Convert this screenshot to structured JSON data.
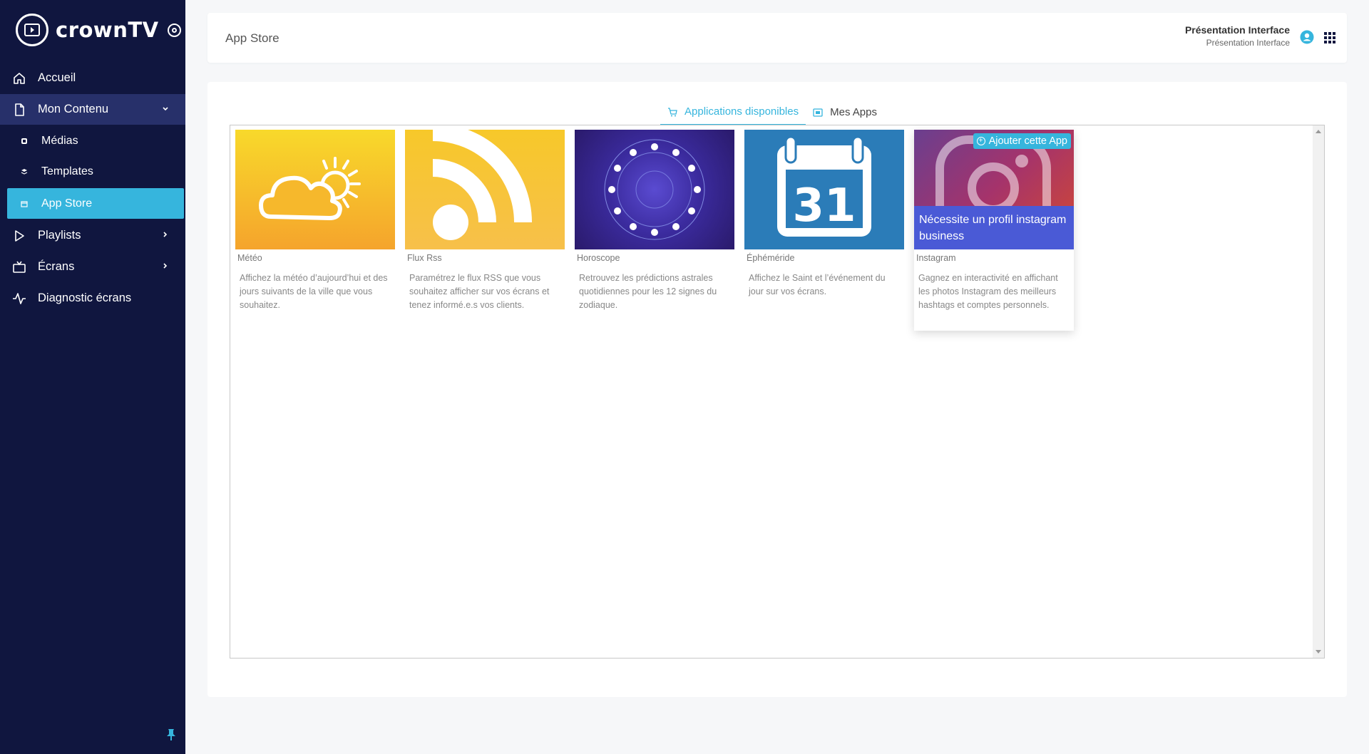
{
  "brand": {
    "name": "crownTV"
  },
  "sidebar": {
    "items": [
      {
        "label": "Accueil",
        "icon": "home-icon"
      },
      {
        "label": "Mon Contenu",
        "icon": "file-icon",
        "expanded": true
      },
      {
        "label": "Playlists",
        "icon": "play-icon"
      },
      {
        "label": "Écrans",
        "icon": "tv-icon"
      },
      {
        "label": "Diagnostic écrans",
        "icon": "activity-icon"
      }
    ],
    "subitems": [
      {
        "label": "Médias",
        "icon": "media-icon"
      },
      {
        "label": "Templates",
        "icon": "template-icon"
      },
      {
        "label": "App Store",
        "icon": "store-icon",
        "active": true
      }
    ],
    "pin_icon": "pin-icon"
  },
  "header": {
    "title": "App Store",
    "user_name": "Présentation Interface",
    "user_sub": "Présentation Interface"
  },
  "tabs": [
    {
      "label": "Applications disponibles",
      "icon": "cart-icon",
      "active": true
    },
    {
      "label": "Mes Apps",
      "icon": "apps-icon",
      "active": false
    }
  ],
  "apps": [
    {
      "name": "Météo",
      "description": "Affichez la météo d’aujourd’hui et des jours suivants de la ville que vous souhaitez.",
      "icon": "weather-icon"
    },
    {
      "name": "Flux Rss",
      "description": "Paramétrez le flux RSS que vous souhaitez afficher sur vos écrans et tenez informé.e.s vos clients.",
      "icon": "rss-icon"
    },
    {
      "name": "Horoscope",
      "description": "Retrouvez les prédictions astrales quotidiennes pour les 12 signes du zodiaque.",
      "icon": "zodiac-icon"
    },
    {
      "name": "Éphéméride",
      "description": "Affichez le Saint et l’événement du jour sur vos écrans.",
      "icon": "calendar-icon",
      "calendar_day": "31"
    },
    {
      "name": "Instagram",
      "description": "Gagnez en interactivité en affichant les photos Instagram des meilleurs hashtags et comptes personnels.",
      "icon": "instagram-icon",
      "overlay": "Nécessite un profil instagram business",
      "add_label": "Ajouter cette App"
    }
  ],
  "colors": {
    "sidebar": "#10163f",
    "accent": "#36b5dd",
    "overlay": "#4a5ad6"
  }
}
